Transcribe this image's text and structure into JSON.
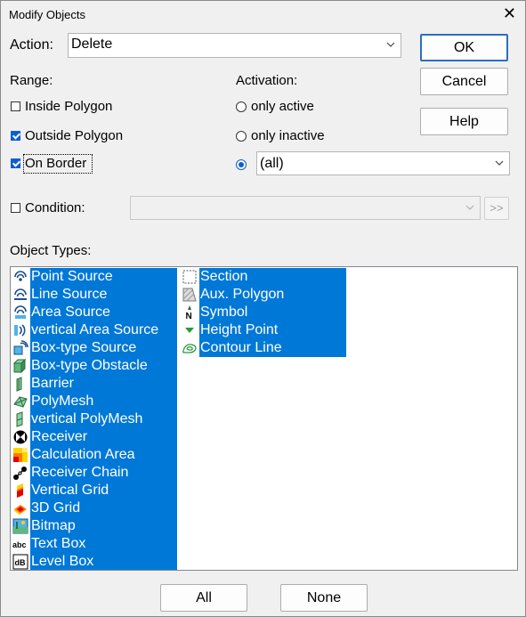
{
  "window": {
    "title": "Modify Objects"
  },
  "action": {
    "label": "Action:",
    "value": "Delete"
  },
  "buttons": {
    "ok": "OK",
    "cancel": "Cancel",
    "help": "Help",
    "all": "All",
    "none": "None",
    "more": ">>"
  },
  "range": {
    "label": "Range:",
    "inside": {
      "label": "Inside Polygon",
      "checked": false
    },
    "outside": {
      "label": "Outside Polygon",
      "checked": true
    },
    "border": {
      "label": "On Border",
      "checked": true
    }
  },
  "activation": {
    "label": "Activation:",
    "only_active": "only active",
    "only_inactive": "only inactive",
    "selected_value": "(all)"
  },
  "condition": {
    "label": "Condition:",
    "checked": false,
    "value": ""
  },
  "object_types": {
    "label": "Object Types:",
    "column1": [
      {
        "label": "Point Source",
        "icon": "point-source-icon"
      },
      {
        "label": "Line Source",
        "icon": "line-source-icon"
      },
      {
        "label": "Area Source",
        "icon": "area-source-icon"
      },
      {
        "label": "vertical Area Source",
        "icon": "vertical-area-source-icon"
      },
      {
        "label": "Box-type Source",
        "icon": "box-source-icon"
      },
      {
        "label": "Box-type Obstacle",
        "icon": "box-obstacle-icon"
      },
      {
        "label": "Barrier",
        "icon": "barrier-icon"
      },
      {
        "label": "PolyMesh",
        "icon": "polymesh-icon"
      },
      {
        "label": "vertical PolyMesh",
        "icon": "vertical-polymesh-icon"
      },
      {
        "label": "Receiver",
        "icon": "receiver-icon"
      },
      {
        "label": "Calculation Area",
        "icon": "calculation-area-icon"
      },
      {
        "label": "Receiver Chain",
        "icon": "receiver-chain-icon"
      },
      {
        "label": "Vertical Grid",
        "icon": "vertical-grid-icon"
      },
      {
        "label": "3D Grid",
        "icon": "3d-grid-icon"
      },
      {
        "label": "Bitmap",
        "icon": "bitmap-icon"
      },
      {
        "label": "Text Box",
        "icon": "text-box-icon"
      },
      {
        "label": "Level Box",
        "icon": "level-box-icon"
      }
    ],
    "column2": [
      {
        "label": "Section",
        "icon": "section-icon"
      },
      {
        "label": "Aux. Polygon",
        "icon": "aux-polygon-icon"
      },
      {
        "label": "Symbol",
        "icon": "symbol-icon"
      },
      {
        "label": "Height Point",
        "icon": "height-point-icon"
      },
      {
        "label": "Contour Line",
        "icon": "contour-line-icon"
      }
    ]
  },
  "colors": {
    "selection": "#0078d7",
    "default_button_border": "#2a6fc4",
    "checkbox": "#0a5ed2"
  },
  "icon_text": {
    "text_box": "abc",
    "level_box": "dB",
    "symbol": "N"
  }
}
